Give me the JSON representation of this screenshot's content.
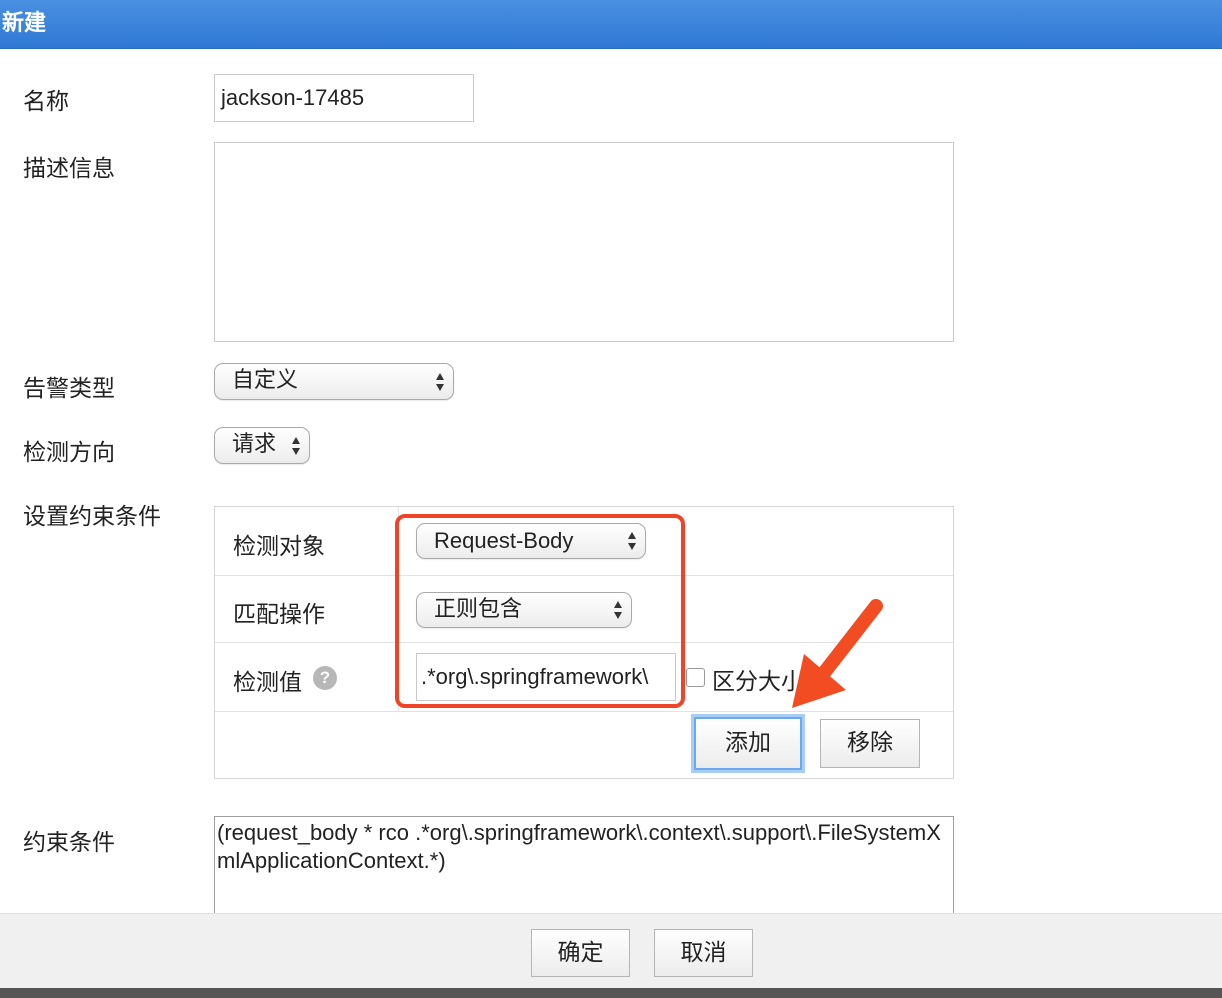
{
  "dialog": {
    "title": "新建"
  },
  "form": {
    "name_label": "名称",
    "name_value": "jackson-17485",
    "description_label": "描述信息",
    "description_value": "",
    "alert_type_label": "告警类型",
    "alert_type_value": "自定义",
    "direction_label": "检测方向",
    "direction_value": "请求",
    "constraints_setup_label": "设置约束条件",
    "constraints_label": "约束条件",
    "constraints_value": "(request_body * rco .*org\\.springframework\\.context\\.support\\.FileSystemXmlApplicationContext.*)"
  },
  "constraint_table": {
    "target_label": "检测对象",
    "target_value": "Request-Body",
    "operation_label": "匹配操作",
    "operation_value": "正则包含",
    "value_label": "检测值",
    "value_input": ".*org\\.springframework\\",
    "help_icon_glyph": "?",
    "case_sensitive_label": "区分大小写",
    "add_button": "添加",
    "remove_button": "移除"
  },
  "footer": {
    "confirm_button": "确定",
    "cancel_button": "取消"
  },
  "colors": {
    "titlebar": "#3a85dc",
    "highlight": "#f0442a",
    "arrow": "#f24c22"
  }
}
